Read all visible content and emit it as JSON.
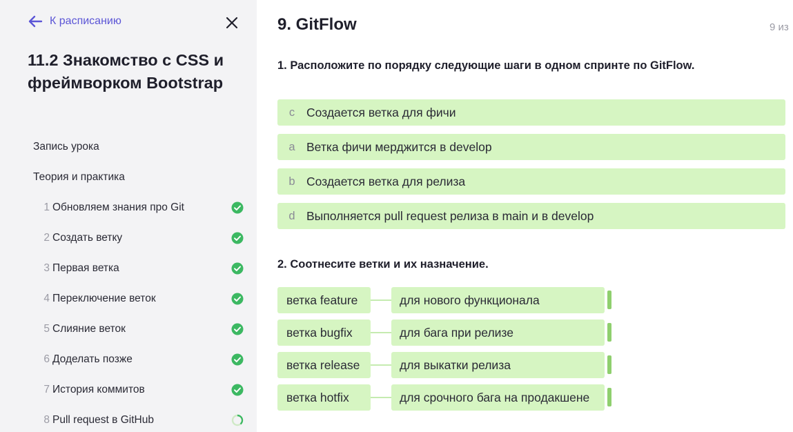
{
  "sidebar": {
    "back_label": "К расписанию",
    "lesson_title": "11.2 Знакомство с CSS и фреймворком Bootstrap",
    "sections": [
      "Запись урока",
      "Теория и практика"
    ],
    "steps": [
      {
        "num": "1",
        "label": "Обновляем знания про Git",
        "status": "done"
      },
      {
        "num": "2",
        "label": "Создать ветку",
        "status": "done"
      },
      {
        "num": "3",
        "label": "Первая ветка",
        "status": "done"
      },
      {
        "num": "4",
        "label": "Переключение веток",
        "status": "done"
      },
      {
        "num": "5",
        "label": "Слияние веток",
        "status": "done"
      },
      {
        "num": "6",
        "label": "Доделать позже",
        "status": "done"
      },
      {
        "num": "7",
        "label": "История коммитов",
        "status": "done"
      },
      {
        "num": "8",
        "label": "Pull request в GitHub",
        "status": "in-progress"
      }
    ]
  },
  "main": {
    "title": "9. GitFlow",
    "counter": "9 из",
    "question1": {
      "title": "1. Расположите по порядку следующие шаги в одном спринте по GitFlow.",
      "items": [
        {
          "letter": "c",
          "text": "Создается ветка для фичи"
        },
        {
          "letter": "a",
          "text": "Ветка фичи мерджится в develop"
        },
        {
          "letter": "b",
          "text": "Создается ветка для релиза"
        },
        {
          "letter": "d",
          "text": "Выполняется pull request релиза в main и в develop"
        }
      ]
    },
    "question2": {
      "title": "2. Соотнесите ветки и их назначение.",
      "pairs": [
        {
          "left": "ветка feature",
          "right": "для нового функционала"
        },
        {
          "left": "ветка bugfix",
          "right": "для бага при релизе"
        },
        {
          "left": "ветка release",
          "right": "для выкатки релиза"
        },
        {
          "left": "ветка hotfix",
          "right": "для срочного бага на продакшене"
        }
      ]
    }
  },
  "colors": {
    "accent": "#5b55d6",
    "success": "#3cb862",
    "answer_bg": "#d6f5c2",
    "handle": "#8fcf6e",
    "sidebar_bg": "#f3f3f5"
  },
  "icons": {
    "back": "arrow-left-icon",
    "close": "close-icon",
    "done": "check-circle-icon",
    "in_progress": "progress-circle-icon"
  }
}
